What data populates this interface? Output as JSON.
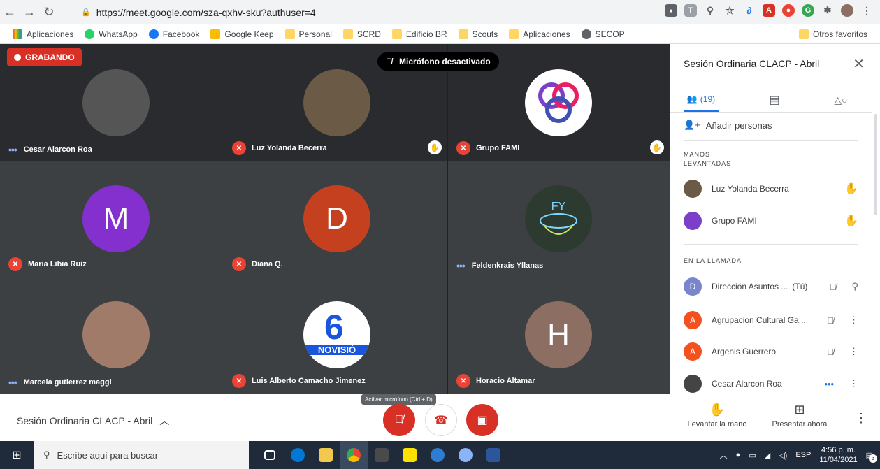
{
  "browser": {
    "url": "https://meet.google.com/sza-qxhv-sku?authuser=4",
    "bookmarks": [
      "Aplicaciones",
      "WhatsApp",
      "Facebook",
      "Google Keep",
      "Personal",
      "SCRD",
      "Edificio BR",
      "Scouts",
      "Aplicaciones",
      "SECOP"
    ],
    "other_bookmarks": "Otros favoritos"
  },
  "meet": {
    "recording_label": "GRABANDO",
    "toast": "Micrófono desactivado",
    "tiles": [
      {
        "name": "Cesar Alarcon Roa",
        "status": "speaking",
        "avatar": "photo",
        "color": "#555555",
        "hand": false
      },
      {
        "name": "Luz Yolanda Becerra",
        "status": "muted",
        "avatar": "photo",
        "color": "#6b5a45",
        "hand": true
      },
      {
        "name": "Grupo FAMI",
        "status": "muted",
        "avatar": "logo",
        "color": "#ffffff",
        "hand": true
      },
      {
        "name": "Maria Libia Ruiz",
        "status": "muted",
        "avatar": "M",
        "color": "#8430ce",
        "hand": false
      },
      {
        "name": "Diana Q.",
        "status": "muted",
        "avatar": "D",
        "color": "#c5401e",
        "hand": false
      },
      {
        "name": "Feldenkrais Yllanas",
        "status": "speaking",
        "avatar": "logo",
        "color": "#2d3a30",
        "hand": false
      },
      {
        "name": "Marcela gutierrez maggi",
        "status": "speaking",
        "avatar": "photo",
        "color": "#a07b6a",
        "hand": false
      },
      {
        "name": "Luis Alberto Camacho Jimenez",
        "status": "muted",
        "avatar": "logo",
        "color": "#ffffff",
        "hand": false
      },
      {
        "name": "Horacio Altamar",
        "status": "muted",
        "avatar": "H",
        "color": "#8d6e63",
        "hand": false
      }
    ],
    "logo_text_fami": "",
    "logo_text_luis": "NOVISIÓ"
  },
  "panel": {
    "title": "Sesión Ordinaria CLACP - Abril",
    "people_count": "(19)",
    "add_people": "Añadir personas",
    "section_raised_1": "MANOS",
    "section_raised_2": "LEVANTADAS",
    "raised": [
      {
        "name": "Luz Yolanda Becerra",
        "color": "#6b5a45"
      },
      {
        "name": "Grupo FAMI",
        "color": "#7b3fc9"
      }
    ],
    "section_call": "EN LA LLAMADA",
    "in_call": [
      {
        "initial": "D",
        "name": "Dirección Asuntos ...",
        "suffix": "(Tú)",
        "color": "#7986cb"
      },
      {
        "initial": "A",
        "name": "Agrupacion Cultural Ga...",
        "suffix": "",
        "color": "#f4511e"
      },
      {
        "initial": "A",
        "name": "Argenis Guerrero",
        "suffix": "",
        "color": "#f4511e"
      },
      {
        "initial": "C",
        "name": "Cesar Alarcon Roa",
        "suffix": "",
        "color": "#444444"
      }
    ]
  },
  "controls": {
    "meeting_name": "Sesión Ordinaria CLACP - Abril",
    "tooltip": "Activar micrófono (Ctrl + D)",
    "raise_hand": "Levantar la mano",
    "present": "Presentar ahora"
  },
  "taskbar": {
    "search_placeholder": "Escribe aquí para buscar",
    "lang": "ESP",
    "time": "4:56 p. m.",
    "date": "11/04/2021",
    "notifications": "3"
  }
}
